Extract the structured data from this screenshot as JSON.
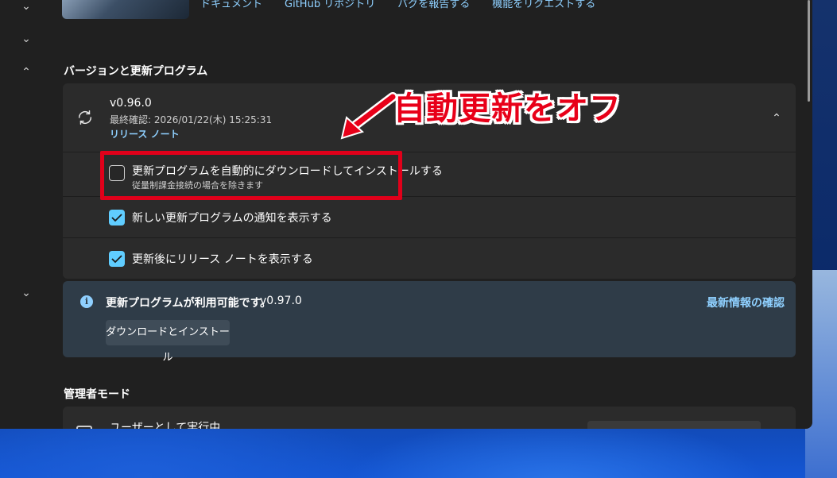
{
  "top_links": [
    "ドキュメント",
    "GitHub リポジトリ",
    "バグを報告する",
    "機能をリクエストする"
  ],
  "version_section": {
    "title": "バージョンと更新プログラム",
    "version": "v0.96.0",
    "last_checked": "最終確認: 2026/01/22(木) 15:25:31",
    "release_notes_link": "リリース ノート",
    "options": [
      {
        "label": "更新プログラムを自動的にダウンロードしてインストールする",
        "sub": "従量制課金接続の場合を除きます",
        "checked": false
      },
      {
        "label": "新しい更新プログラムの通知を表示する",
        "sub": "",
        "checked": true
      },
      {
        "label": "更新後にリリース ノートを表示する",
        "sub": "",
        "checked": true
      }
    ]
  },
  "update_info": {
    "title": "更新プログラムが利用可能です。",
    "new_version": "v0.97.0",
    "link": "最新情報の確認",
    "button": "ダウンロードとインストール"
  },
  "admin_section": {
    "title": "管理者モード",
    "running_as": "ユーザーとして実行中"
  },
  "annotation": {
    "text": "自動更新をオフ",
    "color": "#e80019"
  },
  "colors": {
    "accent": "#60cdff",
    "link": "#8fd0ff",
    "annotation_red": "#e0001a"
  }
}
